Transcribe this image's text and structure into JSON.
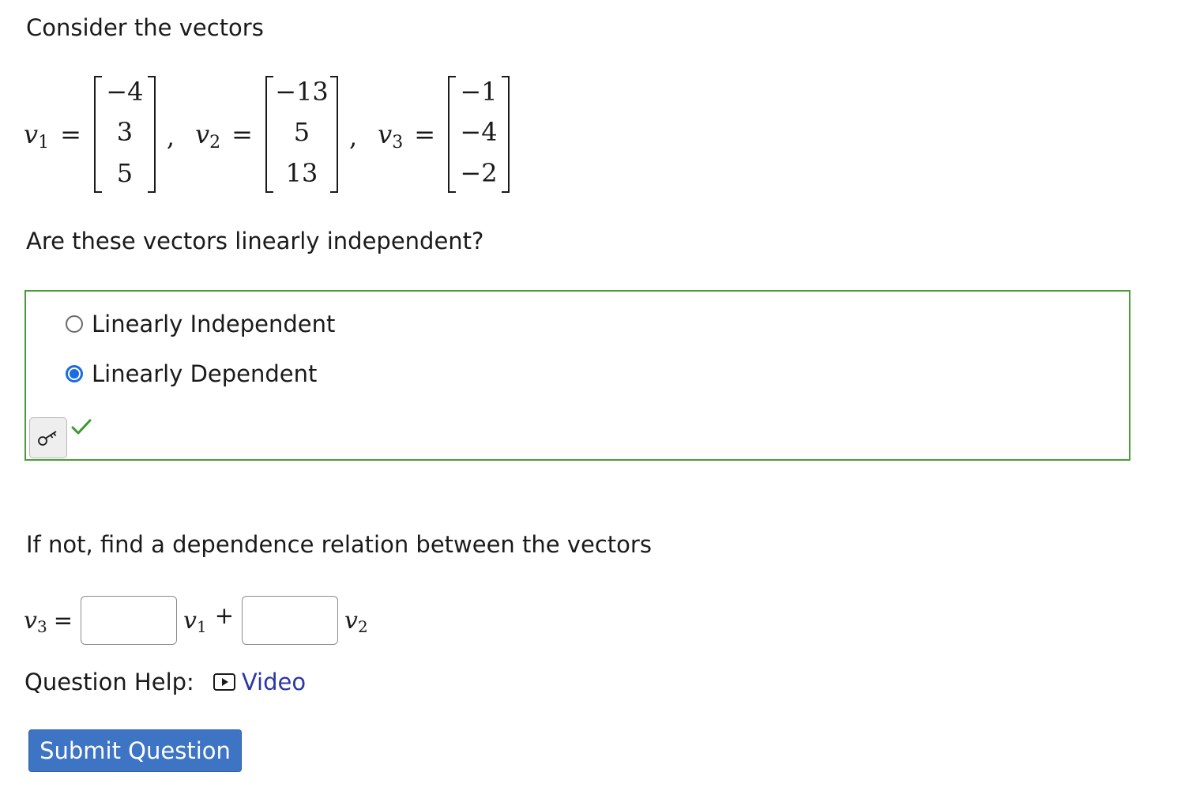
{
  "prompt": {
    "intro": "Consider the vectors",
    "question": "Are these vectors linearly independent?",
    "if_not": "If not, find a dependence relation between the vectors"
  },
  "vectors": [
    {
      "name": "v",
      "sub": "1",
      "entries": [
        "−4",
        "3",
        "5"
      ]
    },
    {
      "name": "v",
      "sub": "2",
      "entries": [
        "−13",
        "5",
        "13"
      ]
    },
    {
      "name": "v",
      "sub": "3",
      "entries": [
        "−1",
        "−4",
        "−2"
      ]
    }
  ],
  "symbols": {
    "equals": "=",
    "comma": ",",
    "plus": "+"
  },
  "choices": {
    "options": [
      {
        "label": "Linearly Independent",
        "selected": false
      },
      {
        "label": "Linearly Dependent",
        "selected": true
      }
    ],
    "status": "correct",
    "key_icon": "key-icon",
    "check_icon": "check-icon",
    "status_color": "#3a9a2e",
    "border_color": "#4a9e3a"
  },
  "relation": {
    "lhs": {
      "name": "v",
      "sub": "3"
    },
    "term1": {
      "name": "v",
      "sub": "1",
      "value": ""
    },
    "term2": {
      "name": "v",
      "sub": "2",
      "value": ""
    }
  },
  "help": {
    "label": "Question Help:",
    "icon": "video-icon",
    "link_text": "Video",
    "link_color": "#2a37a8"
  },
  "submit": {
    "label": "Submit Question",
    "color": "#3d74c4"
  }
}
